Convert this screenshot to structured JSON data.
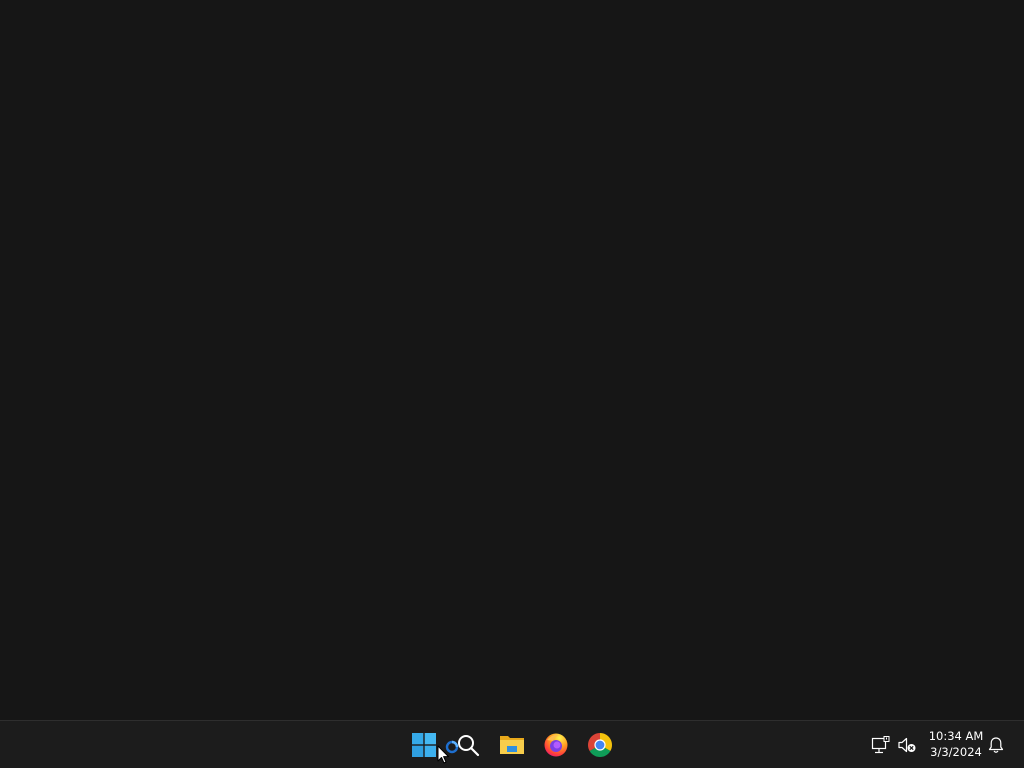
{
  "taskbar": {
    "pinned": [
      {
        "name": "Start",
        "icon": "windows-logo-icon",
        "color": "#3fb4f0"
      },
      {
        "name": "Search",
        "icon": "search-icon",
        "color": "#ffffff"
      },
      {
        "name": "File Explorer",
        "icon": "folder-icon",
        "color": "#f2c443"
      },
      {
        "name": "Firefox",
        "icon": "firefox-icon",
        "color": "#ff7139"
      },
      {
        "name": "Google Chrome",
        "icon": "chrome-icon",
        "color": "#4285f4"
      }
    ],
    "tray": {
      "network_icon": "network-disconnected-icon",
      "volume_icon": "volume-muted-icon",
      "notification_icon": "bell-icon"
    },
    "clock": {
      "time": "10:34 AM",
      "date": "3/3/2024"
    }
  },
  "colors": {
    "desktop_bg": "#161616",
    "taskbar_bg": "#1c1c1c"
  }
}
